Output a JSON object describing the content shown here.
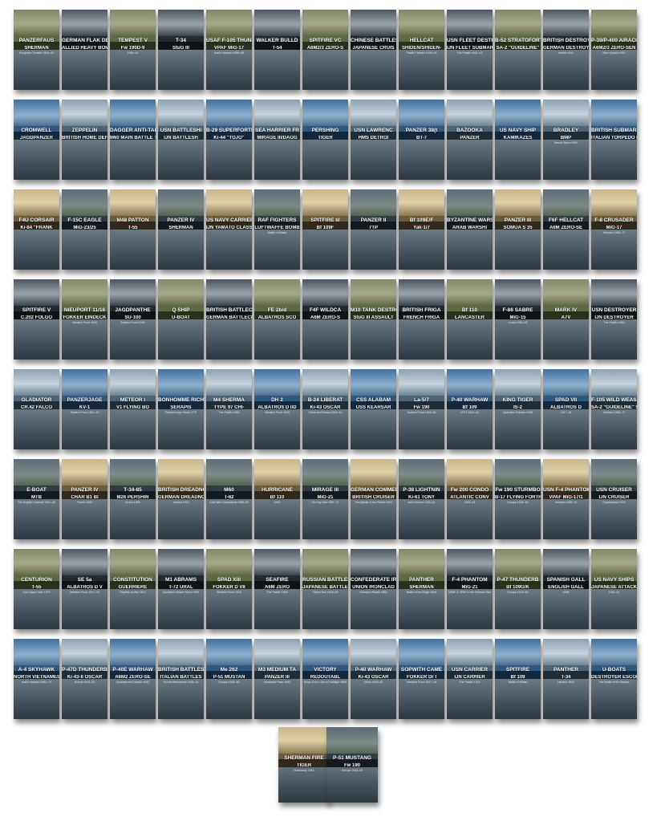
{
  "rows": [
    [
      {
        "t1": "PANZERFAUS",
        "t2": "SHERMAN",
        "meta": "European Theater 1944–45"
      },
      {
        "t1": "GERMAN FLAK DEFE",
        "t2": "ALLIED HEAVY BOMB",
        "meta": ""
      },
      {
        "t1": "TEMPEST V",
        "t2": "Fw 190D-9",
        "meta": "1944–45"
      },
      {
        "t1": "T-34",
        "t2": "StuG III",
        "meta": ""
      },
      {
        "t1": "USAF F-105 THUNDERC",
        "t2": "VPAF MiG-17",
        "meta": "North Vietnam 1965–68"
      },
      {
        "t1": "WALKER BULLD",
        "t2": "T-54",
        "meta": ""
      },
      {
        "t1": "SPITFIRE VC",
        "t2": "A6M2/3 ZERO-S",
        "meta": ""
      },
      {
        "t1": "CHINESE BATTLES",
        "t2": "JAPANESE CRUIS",
        "meta": ""
      },
      {
        "t1": "HELLCAT",
        "t2": "SHIDEN/SHIDEN-",
        "meta": "Pacific Theater 1944–45"
      },
      {
        "t1": "USN FLEET DESTRO",
        "t2": "IJN FLEET SUBMAR",
        "meta": "The Pacific 1941–43"
      },
      {
        "t1": "B-52 STRATOFORTR",
        "t2": "SA-2 \"GUIDELINE\" ",
        "meta": ""
      },
      {
        "t1": "BRITISH DESTROY",
        "t2": "GERMAN DESTROYE",
        "meta": "Narvik 1940"
      },
      {
        "t1": "P-39/P-400 AIRACOBRA",
        "t2": "A6M2/3 ZERO-SEN",
        "meta": "New Guinea 1942"
      }
    ],
    [
      {
        "t1": "CROMWELL",
        "t2": "JAGDPANZER",
        "meta": ""
      },
      {
        "t1": "ZEPPELIN",
        "t2": "BRITISH HOME DEF",
        "meta": ""
      },
      {
        "t1": "DAGGER ANTI-TANK MI",
        "t2": "M60 MAIN BATTLE TA",
        "meta": ""
      },
      {
        "t1": "USN BATTLESHI",
        "t2": "IJN BATTLESH",
        "meta": ""
      },
      {
        "t1": "B-29 SUPERFORTR",
        "t2": "Ki-44 \"TOJO\"",
        "meta": ""
      },
      {
        "t1": "SEA HARRIER FR",
        "t2": "MIRAGE III/DAGG",
        "meta": ""
      },
      {
        "t1": "PERSHING",
        "t2": "TIGER",
        "meta": ""
      },
      {
        "t1": "USN LAWRENC",
        "t2": "HMS DETROI",
        "meta": ""
      },
      {
        "t1": "PANZER 38(t",
        "t2": "BT-7",
        "meta": ""
      },
      {
        "t1": "BAZOOKA",
        "t2": "PANZER",
        "meta": ""
      },
      {
        "t1": "US NAVY SHIP",
        "t2": "KAMIKAZES",
        "meta": ""
      },
      {
        "t1": "BRADLEY",
        "t2": "BMP",
        "meta": "Desert Storm 1991"
      },
      {
        "t1": "BRITISH SUBMARINE",
        "t2": "ITALIAN TORPEDO BOAT",
        "meta": ""
      }
    ],
    [
      {
        "t1": "F4U CORSAIR",
        "t2": "Ki-84 \"FRANK",
        "meta": ""
      },
      {
        "t1": "F-15C EAGLE",
        "t2": "MiG-23/25",
        "meta": ""
      },
      {
        "t1": "M48 PATTON",
        "t2": "T-55",
        "meta": ""
      },
      {
        "t1": "PANZER IV",
        "t2": "SHERMAN",
        "meta": ""
      },
      {
        "t1": "US NAVY CARRIER AIRC",
        "t2": "IJN YAMATO CLASS BATTL",
        "meta": ""
      },
      {
        "t1": "RAF FIGHTERS",
        "t2": "LUFTWAFFE BOMB",
        "meta": "Battle of Britain"
      },
      {
        "t1": "SPITFIRE II/",
        "t2": "Bf 109F",
        "meta": ""
      },
      {
        "t1": "PANZER II",
        "t2": "7TP",
        "meta": ""
      },
      {
        "t1": "Bf 109E/F",
        "t2": "Yak-1/7",
        "meta": ""
      },
      {
        "t1": "BYZANTINE WARS",
        "t2": "ARAB WARSHI",
        "meta": ""
      },
      {
        "t1": "PANZER III",
        "t2": "SOMUA S 35",
        "meta": ""
      },
      {
        "t1": "F6F HELLCAT",
        "t2": "A6M ZERO-SE",
        "meta": ""
      },
      {
        "t1": "F-8 CRUSADER",
        "t2": "MiG-17",
        "meta": "Vietnam 1965–72"
      }
    ],
    [
      {
        "t1": "SPITFIRE V",
        "t2": "C.202 FOLGO",
        "meta": ""
      },
      {
        "t1": "NIEUPORT 11/16",
        "t2": "FOKKER EINDECK",
        "meta": "Western Front 1916"
      },
      {
        "t1": "JAGDPANTHE",
        "t2": "SU-100",
        "meta": "Eastern Front 1945"
      },
      {
        "t1": "Q SHIP",
        "t2": "U-BOAT",
        "meta": ""
      },
      {
        "t1": "BRITISH BATTLECRU",
        "t2": "GERMAN BATTLECRU",
        "meta": ""
      },
      {
        "t1": "FE 2b/d",
        "t2": "ALBATROS SCO",
        "meta": ""
      },
      {
        "t1": "F4F WILDCA",
        "t2": "A6M ZERO-S",
        "meta": ""
      },
      {
        "t1": "M10 TANK DESTRO",
        "t2": "StuG III ASSAULT",
        "meta": ""
      },
      {
        "t1": "BRITISH FRIGA",
        "t2": "FRENCH FRIGA",
        "meta": ""
      },
      {
        "t1": "Bf 110",
        "t2": "LANCASTER",
        "meta": ""
      },
      {
        "t1": "F-86 SABRE",
        "t2": "MiG-15",
        "meta": "Korea 1950–53"
      },
      {
        "t1": "MARK IV",
        "t2": "A7V",
        "meta": ""
      },
      {
        "t1": "USN DESTROYER",
        "t2": "IJN DESTROYER",
        "meta": "The Pacific 1943"
      }
    ],
    [
      {
        "t1": "GLADIATOR",
        "t2": "CR.42 FALCO",
        "meta": ""
      },
      {
        "t1": "PANZERJÄGE",
        "t2": "KV-1",
        "meta": "Eastern Front 1941–43"
      },
      {
        "t1": "METEOR I",
        "t2": "V1 FLYING BO",
        "meta": ""
      },
      {
        "t1": "BONHOMME RICHA",
        "t2": "SERAPIS",
        "meta": "Flamborough Head 1779"
      },
      {
        "t1": "M4 SHERMA",
        "t2": "TYPE 97 CHI-",
        "meta": "The Pacific 1945"
      },
      {
        "t1": "DH 2",
        "t2": "ALBATROS D I/D",
        "meta": "Western Front 1916"
      },
      {
        "t1": "B-24 LIBERAT",
        "t2": "Ki-43 OSCAR",
        "meta": "China and Burma 1943–44"
      },
      {
        "t1": "CSS ALABAM",
        "t2": "USS KEARSAR",
        "meta": ""
      },
      {
        "t1": "La-5/7",
        "t2": "Fw 190",
        "meta": "Eastern Front 1942–45"
      },
      {
        "t1": "P-40 WARHAW",
        "t2": "Bf 109",
        "meta": "MTO 1942–44"
      },
      {
        "t1": "KING TIGER",
        "t2": "IS-2",
        "meta": "Operation Solstice 1945"
      },
      {
        "t1": "SPAD VII",
        "t2": "ALBATROS D",
        "meta": "1917–18"
      },
      {
        "t1": "F-105 WILD WEASEL",
        "t2": "SA-2 \"GUIDELINE\" SAM",
        "meta": "Vietnam 1965–73"
      }
    ],
    [
      {
        "t1": "E-BOAT",
        "t2": "MTB",
        "meta": "The English Channel 1941–45"
      },
      {
        "t1": "PANZER IV",
        "t2": "CHAR B1 BI",
        "meta": "France 1940"
      },
      {
        "t1": "T-34-85",
        "t2": "M26 PERSHIN",
        "meta": "Korea 1950"
      },
      {
        "t1": "BRITISH DREADNOU",
        "t2": "GERMAN DREADNOU",
        "meta": "Jutland 1916"
      },
      {
        "t1": "M60",
        "t2": "T-62",
        "meta": "Cold War Combatants 1956–92"
      },
      {
        "t1": "HURRICANE",
        "t2": "Bf 110",
        "meta": "1940"
      },
      {
        "t1": "MIRAGE III",
        "t2": "MiG-21",
        "meta": "Six Day War 1967–70"
      },
      {
        "t1": "GERMAN COMMERCE RA",
        "t2": "BRITISH CRUISER",
        "meta": "The Atlantic & the Pacific 1941"
      },
      {
        "t1": "P-38 LIGHTNIN",
        "t2": "Ki-61 TONY",
        "meta": "New Guinea 1943–44"
      },
      {
        "t1": "Fw 200 CONDO",
        "t2": "ATLANTIC CONV",
        "meta": "1941–43"
      },
      {
        "t1": "Fw 190 STURMBO",
        "t2": "B-17 FLYING FORTR",
        "meta": "Europe 1944–45"
      },
      {
        "t1": "USN F-4 PHANTOM",
        "t2": "VPAF MiG-17/1",
        "meta": "Vietnam 1965–73"
      },
      {
        "t1": "USN CRUISER",
        "t2": "IJN CRUISER",
        "meta": "Guadalcanal 1942"
      }
    ],
    [
      {
        "t1": "CENTURION",
        "t2": "T-55",
        "meta": "Yom Kippur War 1973"
      },
      {
        "t1": "SE 5a",
        "t2": "ALBATROS D V",
        "meta": "Western Front 1917–18"
      },
      {
        "t1": "CONSTITUTION",
        "t2": "GUERRIERE",
        "meta": "Frigates at War 1812"
      },
      {
        "t1": "M1 ABRAMS",
        "t2": "T-72 URAL",
        "meta": "Operation Desert Storm 1991"
      },
      {
        "t1": "SPAD XIII",
        "t2": "FOKKER D VII",
        "meta": "Western Front 1918"
      },
      {
        "t1": "SEAFIRE",
        "t2": "A6M ZERO",
        "meta": "The Pacific 1945"
      },
      {
        "t1": "RUSSIAN BATTLESH",
        "t2": "JAPANESE BATTLES",
        "meta": "Yellow Sea 1904–05"
      },
      {
        "t1": "CONFEDERATE IRONC",
        "t2": "UNION IRONCLAD",
        "meta": "Hampton Roads 1862"
      },
      {
        "t1": "PANTHER",
        "t2": "SHERMAN",
        "meta": "Battle of the Bulge 1944"
      },
      {
        "t1": "F-4 PHANTOM",
        "t2": "MiG-21",
        "meta": "USAF & VPAF in the Vietnam War"
      },
      {
        "t1": "P-47 THUNDERB",
        "t2": "Bf 109G/K",
        "meta": "Europe 1943–45"
      },
      {
        "t1": "SPANISH GALL",
        "t2": "ENGLISH GALL",
        "meta": "1588"
      },
      {
        "t1": "US NAVY SHIPS",
        "t2": "JAPANESE ATTACK AIRCRAFT",
        "meta": "1941–42"
      }
    ],
    [
      {
        "t1": "A-4 SKYHAWK",
        "t2": "NORTH VIETNAMESE",
        "meta": "North Vietnam 1964–73"
      },
      {
        "t1": "P-47D THUNDERB",
        "t2": "Ki-43-II OSCAR",
        "meta": "Burma 1944–45"
      },
      {
        "t1": "P-40E WARHAW",
        "t2": "A6M2 ZERO-SE",
        "meta": "Australia and Darwin 1942"
      },
      {
        "t1": "BRITISH BATTLES",
        "t2": "ITALIAN BATTLES",
        "meta": "The Mediterranean 1940–41"
      },
      {
        "t1": "Me 262",
        "t2": "P-51 MUSTAN",
        "meta": "Europe 1944–45"
      },
      {
        "t1": "M3 MEDIUM TA",
        "t2": "PANZER III",
        "meta": "Kasserine Pass 1943"
      },
      {
        "t1": "VICTORY",
        "t2": "REDOUTABL",
        "meta": "Ships of the Line at Trafalgar 1805"
      },
      {
        "t1": "P-40 WARHAW",
        "t2": "Ki-43 OSCAR",
        "meta": "China 1944–45"
      },
      {
        "t1": "SOPWITH CAME",
        "t2": "FOKKER Dr I",
        "meta": "Western Front 1917–18"
      },
      {
        "t1": "USN CARRIER",
        "t2": "IJN CARRIER",
        "meta": "The Pacific 1942"
      },
      {
        "t1": "SPITFIRE",
        "t2": "Bf 109",
        "meta": "Battle of Britain"
      },
      {
        "t1": "PANTHER",
        "t2": "T-34",
        "meta": "Ukraine 1943"
      },
      {
        "t1": "U-BOATS",
        "t2": "DESTROYER ESCORTS",
        "meta": "The Battle of the Atlantic"
      }
    ],
    [
      {
        "t1": "SHERMAN FIRE",
        "t2": "TIGER",
        "meta": "Normandy 1944"
      },
      {
        "t1": "P-51 MUSTANG",
        "t2": "Fw 190",
        "meta": "Europe 1943–45"
      }
    ]
  ]
}
